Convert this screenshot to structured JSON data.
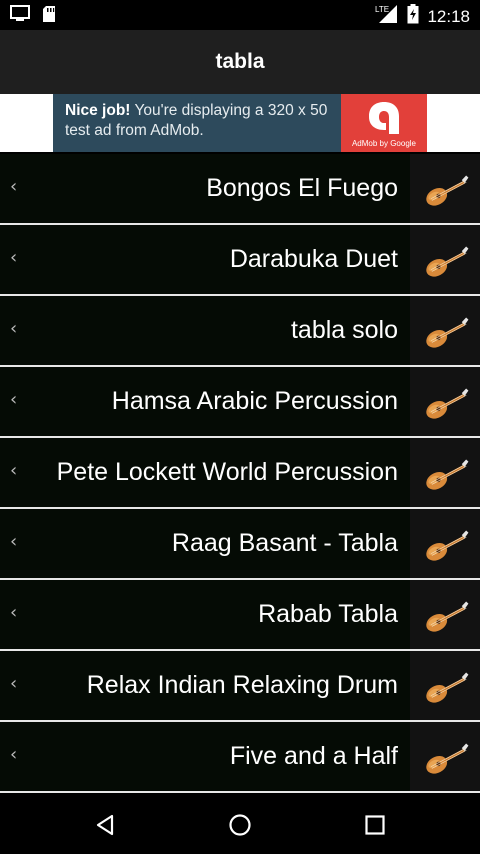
{
  "status_bar": {
    "time": "12:18",
    "network": "LTE",
    "left_icons": [
      "screen-cast-icon",
      "sd-card-icon"
    ],
    "right_icons": [
      "signal-icon",
      "battery-icon"
    ]
  },
  "app_bar": {
    "title": "tabla"
  },
  "ad": {
    "bold": "Nice job!",
    "text": " You're displaying a 320 x 50 test ad from AdMob.",
    "badge_caption": "AdMob by Google",
    "colors": {
      "background": "#2d4a5c",
      "badge": "#e2403a"
    }
  },
  "list": {
    "items": [
      {
        "label": "Bongos El Fuego",
        "icon": "oud-icon"
      },
      {
        "label": "Darabuka Duet",
        "icon": "oud-icon"
      },
      {
        "label": "tabla solo",
        "icon": "oud-icon"
      },
      {
        "label": "Hamsa Arabic Percussion",
        "icon": "oud-icon"
      },
      {
        "label": "Pete Lockett World Percussion",
        "icon": "oud-icon"
      },
      {
        "label": "Raag Basant - Tabla",
        "icon": "oud-icon"
      },
      {
        "label": "Rabab Tabla",
        "icon": "oud-icon"
      },
      {
        "label": "Relax Indian Relaxing Drum",
        "icon": "oud-icon"
      },
      {
        "label": "Five and a Half",
        "icon": "oud-icon"
      }
    ]
  },
  "nav_bar": {
    "buttons": [
      "back-icon",
      "home-icon",
      "recents-icon"
    ]
  }
}
